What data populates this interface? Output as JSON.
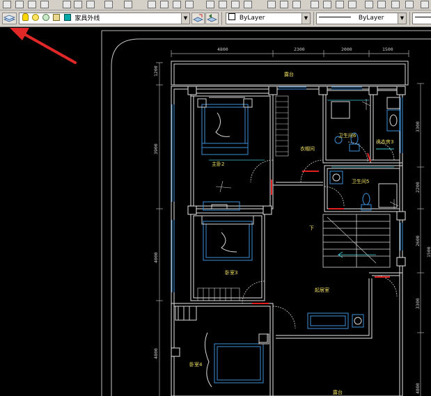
{
  "toolbar": {
    "layer_name": "家具外线",
    "color_value": "ByLayer",
    "linetype_value": "ByLayer",
    "layer_color": "#00a8a8"
  },
  "drawing": {
    "dims_top": [
      "4800",
      "2300",
      "2000",
      "1500"
    ],
    "dims_left": [
      "1200",
      "3900",
      "4000",
      "4800"
    ],
    "dims_right": [
      "3300",
      "2200",
      "2600",
      "1500",
      "3300",
      "4800"
    ],
    "rooms": {
      "terrace_top": "露台",
      "master_bed": "主卧2",
      "cloakroom": "衣帽间",
      "bath6": "卫生间6",
      "laundry": "洗衣房3",
      "bath5": "卫生间5",
      "stair_down": "下",
      "bedroom3": "卧室3",
      "living": "起居室",
      "bedroom4": "卧室4",
      "terrace_bottom": "露台"
    },
    "colors": {
      "wall": "#e6e6e6",
      "blue": "#3b8fd8",
      "cyan": "#3ec9d8",
      "red": "#e02020",
      "label": "#f0e060",
      "dim": "#c8c8c8"
    }
  }
}
